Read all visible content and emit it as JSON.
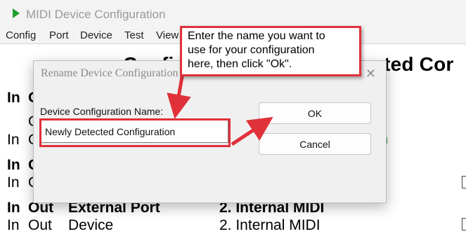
{
  "window": {
    "title": "MIDI Device Configuration",
    "icon": "green-play-triangle-icon"
  },
  "menu": [
    "Config",
    "Port",
    "Device",
    "Test",
    "View"
  ],
  "background": {
    "heading_left": "Config",
    "heading_right": "tected Cor",
    "rows": [
      {
        "col1": "In",
        "col2": "O"
      },
      {
        "col1": "",
        "col2": "O"
      },
      {
        "col1": "In",
        "col2": "O"
      },
      {
        "col1": "In",
        "col2": "O"
      },
      {
        "col1": "In",
        "col2": "O"
      }
    ],
    "green_fragment": "n",
    "bottom_row1": {
      "in": "In",
      "out": "Out",
      "port": "External Port",
      "midi": "2. Internal MIDI"
    },
    "bottom_row2": {
      "in": "In",
      "out": "Out",
      "port": "Device",
      "midi": "2. Internal MIDI"
    }
  },
  "dialog": {
    "title": "Rename Device Configuration",
    "close_glyph": "✕",
    "field_label": "Device Configuration Name:",
    "name_value": "Newly Detected Configuration",
    "ok_label": "OK",
    "cancel_label": "Cancel"
  },
  "annotation": {
    "lines": [
      "Enter the name you want to",
      "use for your configuration",
      "here, then click \"Ok\"."
    ],
    "color": "#e0313a"
  }
}
